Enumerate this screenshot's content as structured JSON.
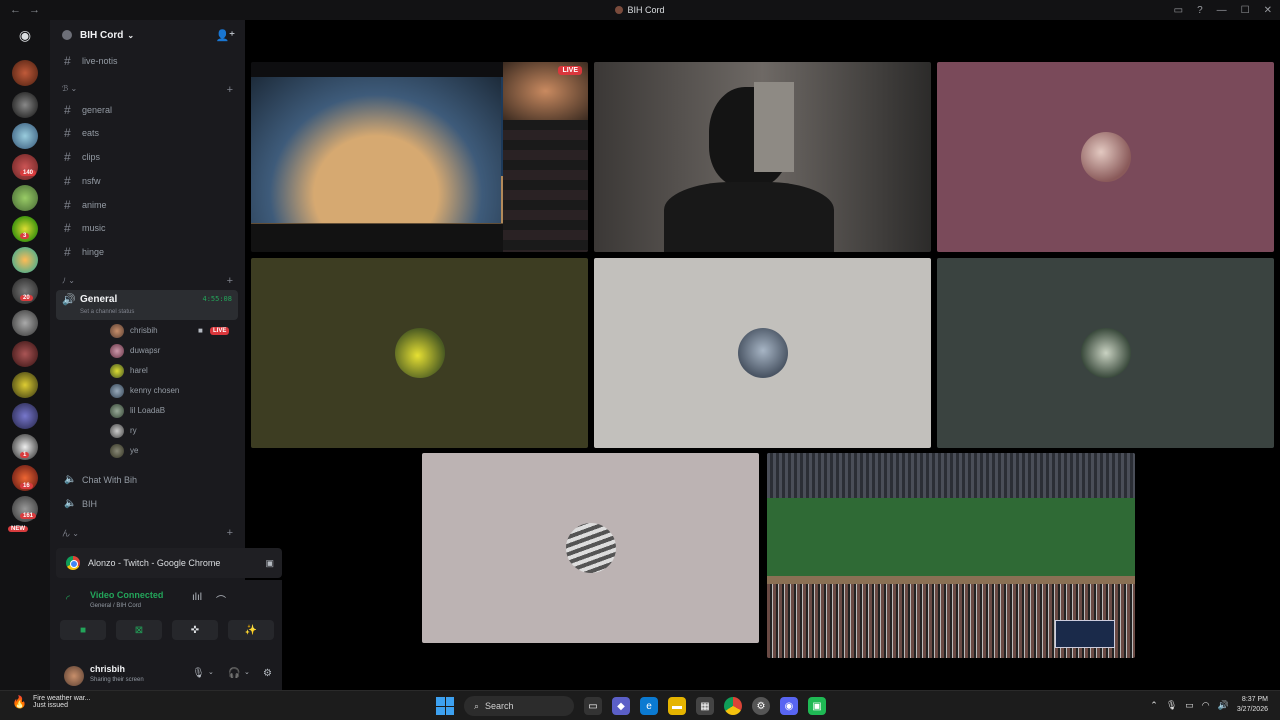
{
  "window": {
    "title": "BIH Cord",
    "back": "←",
    "forward": "→"
  },
  "server": {
    "name": "BIH Cord"
  },
  "channels_top": [
    {
      "label": "live-notis"
    }
  ],
  "category1": {
    "label": "ℬ"
  },
  "text_channels": [
    {
      "label": "general"
    },
    {
      "label": "eats"
    },
    {
      "label": "clips"
    },
    {
      "label": "nsfw"
    },
    {
      "label": "anime"
    },
    {
      "label": "music"
    },
    {
      "label": "hinge"
    }
  ],
  "category2": {
    "label": "ﾉ"
  },
  "voice": {
    "name": "General",
    "timer": "4:55:08",
    "status": "Set a channel status",
    "users": [
      {
        "name": "chrisbih",
        "live": "LIVE"
      },
      {
        "name": "duwapsr"
      },
      {
        "name": "harel"
      },
      {
        "name": "kenny chosen"
      },
      {
        "name": "lil LoadaB"
      },
      {
        "name": "ry"
      },
      {
        "name": "ye"
      }
    ]
  },
  "voice_channels": [
    {
      "label": "Chat With Bih"
    },
    {
      "label": "BIH"
    }
  ],
  "category3": {
    "label": "ん"
  },
  "rail": {
    "badges": [
      "140",
      "3",
      "20",
      "1",
      "16",
      "161"
    ],
    "new_label": "NEW"
  },
  "share": {
    "label": "Alonzo - Twitch - Google Chrome"
  },
  "connection": {
    "status": "Video Connected",
    "location": "General / BIH Cord"
  },
  "user": {
    "name": "chrisbih",
    "status": "Sharing their screen"
  },
  "tiles": {
    "live_label": "LIVE",
    "colors": {
      "mauve": "#7a4a5a",
      "olive": "#3d3d22",
      "light": "#c2c0bc",
      "slate": "#3a4340",
      "pinkgray": "#bcb3b3"
    }
  },
  "taskbar": {
    "weather_title": "Fire weather war...",
    "weather_sub": "Just issued",
    "search": "Search",
    "time": "8:37 PM",
    "date": "3/27/2026"
  }
}
